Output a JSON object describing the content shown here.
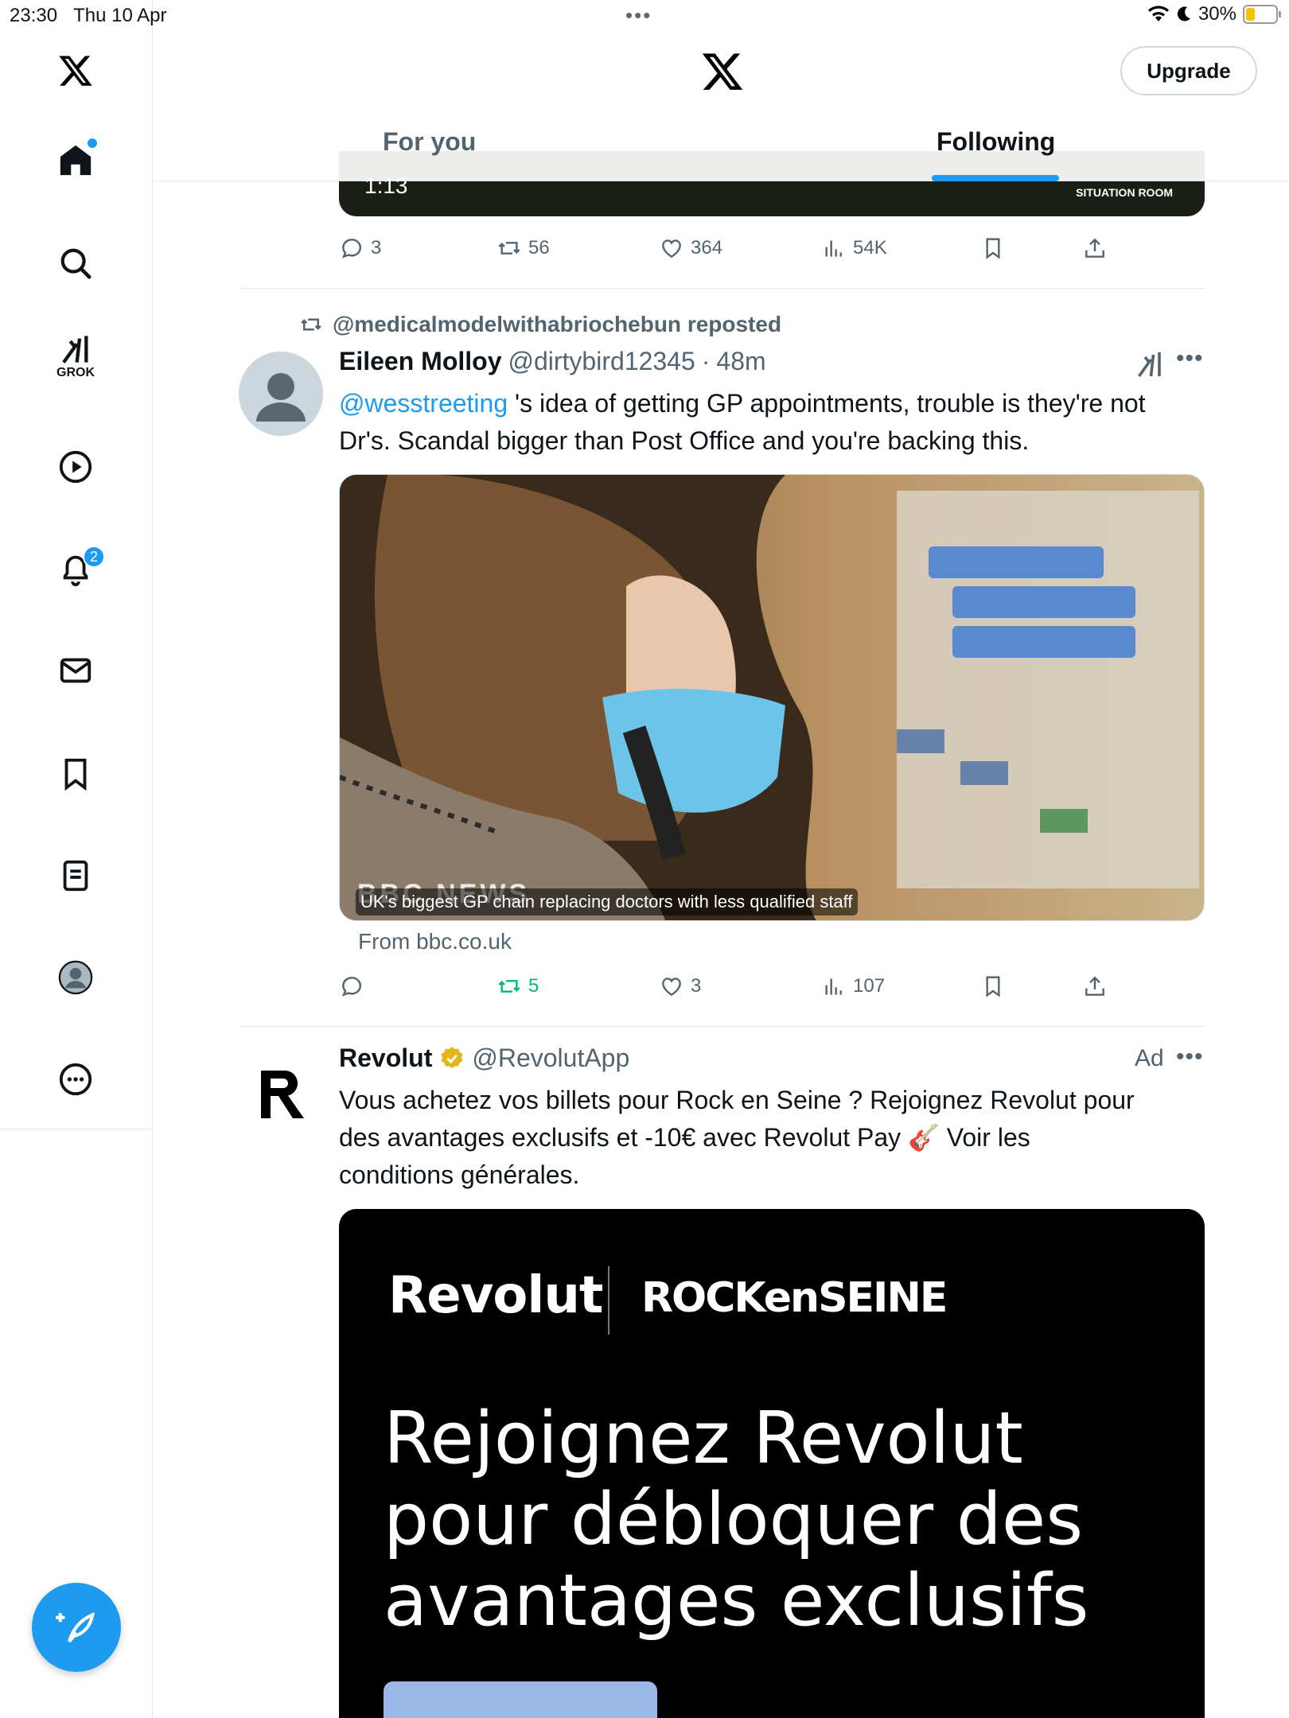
{
  "status": {
    "time": "23:30",
    "date": "Thu 10 Apr",
    "battery": "30%"
  },
  "sidebar": {
    "items": [
      {
        "name": "home"
      },
      {
        "name": "search"
      },
      {
        "name": "grok",
        "label": "GROK"
      },
      {
        "name": "video"
      },
      {
        "name": "notifications",
        "badge": "2"
      },
      {
        "name": "messages"
      },
      {
        "name": "bookmarks"
      },
      {
        "name": "lists"
      },
      {
        "name": "profile"
      },
      {
        "name": "more"
      }
    ]
  },
  "header": {
    "upgrade_label": "Upgrade",
    "tabs": [
      {
        "label": "For you"
      },
      {
        "label": "Following",
        "active": true
      }
    ]
  },
  "prev_tweet": {
    "video_time": "1:13",
    "video_overlay": "SITUATION ROOM",
    "actions": {
      "replies": "3",
      "reposts": "56",
      "likes": "364",
      "views": "54K"
    }
  },
  "tweet": {
    "repost_by": "@medicalmodelwithabriochebun reposted",
    "name": "Eileen Molloy",
    "handle": "@dirtybird12345",
    "sep": "·",
    "time": "48m",
    "mention": "@wesstreeting",
    "text_line1": " 's idea of getting GP appointments, trouble is they're not",
    "text_line2": "Dr's. Scandal bigger than Post Office and you're backing this.",
    "media_caption": "UK's biggest GP chain replacing doctors with less qualified staff",
    "media_logo": "BBC NEWS",
    "from": "From bbc.co.uk",
    "actions": {
      "replies": "",
      "reposts": "5",
      "likes": "3",
      "views": "107"
    }
  },
  "ad": {
    "name": "Revolut",
    "handle": "@RevolutApp",
    "label": "Ad",
    "text_line1": "Vous achetez vos billets pour Rock en Seine ? Rejoignez Revolut pour",
    "text_line2": "des avantages exclusifs et -10€ avec Revolut Pay 🎸 Voir les",
    "text_line3": "conditions générales.",
    "media": {
      "brand": "Revolut",
      "brand2": "ROCKenSEINE",
      "headline_1": "Rejoignez Revolut",
      "headline_2": "pour débloquer des",
      "headline_3": "avantages exclusifs"
    }
  },
  "colors": {
    "accent": "#1d9bf0",
    "repost_green": "#00ba7c",
    "muted": "#536471"
  }
}
